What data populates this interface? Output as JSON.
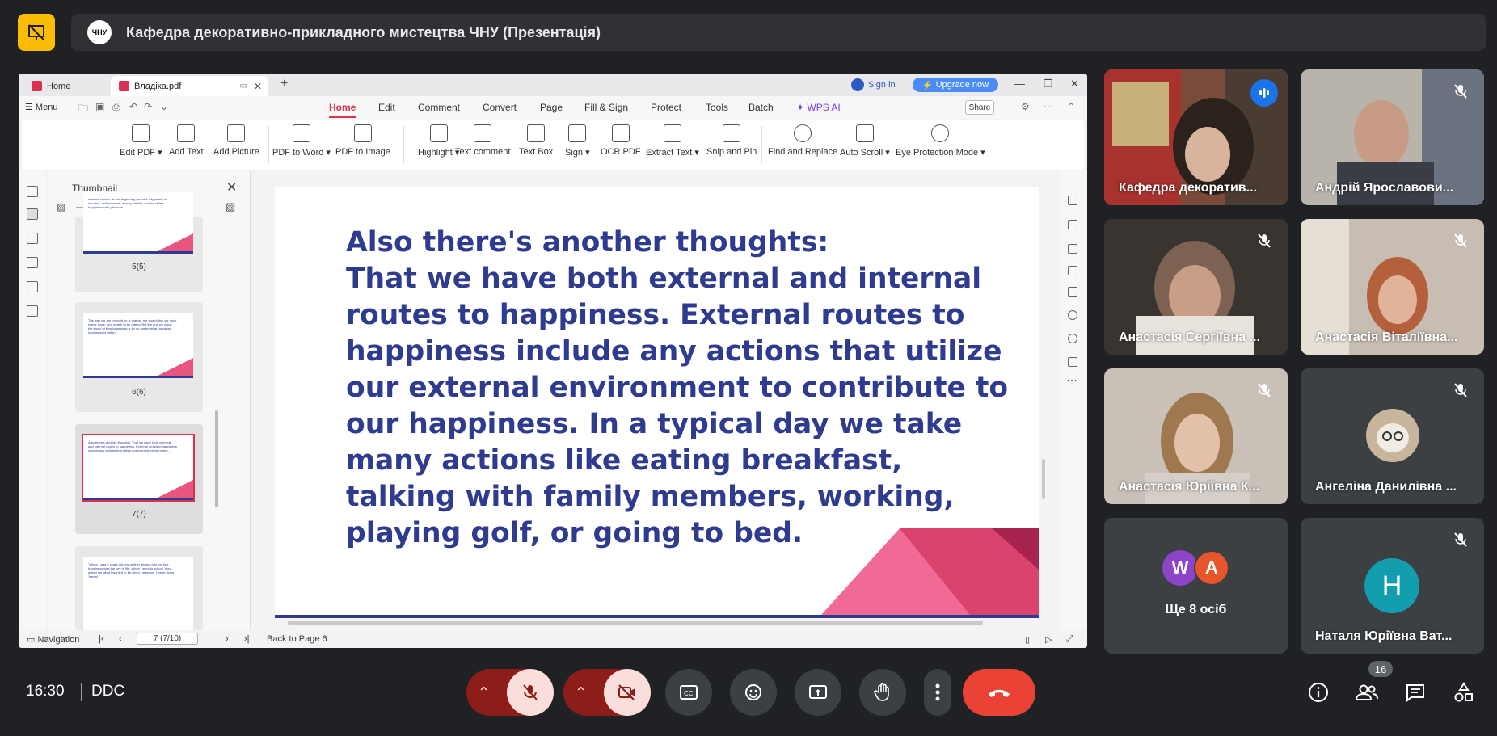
{
  "meeting": {
    "presentation_title": "Кафедра декоративно-прикладного мистецтва ЧНУ (Презентація)",
    "clock": "16:30",
    "meeting_code": "DDC",
    "participants_count": "16"
  },
  "browser": {
    "tabs": [
      {
        "label": "Home"
      },
      {
        "label": "Владіка.pdf"
      }
    ],
    "sign_in": "Sign in",
    "upgrade": "Upgrade now"
  },
  "pdf_app": {
    "menu_label": "Menu",
    "menu_tabs": [
      "Home",
      "Edit",
      "Comment",
      "Convert",
      "Page",
      "Fill & Sign",
      "Protect",
      "Tools",
      "Batch",
      "WPS AI"
    ],
    "share": "Share",
    "ribbon": [
      {
        "label": "Edit PDF ▾"
      },
      {
        "label": "Add Text"
      },
      {
        "label": "Add Picture"
      },
      {
        "label": "PDF to Word ▾"
      },
      {
        "label": "PDF to Image"
      },
      {
        "label": "Highlight ▾"
      },
      {
        "label": "Text comment"
      },
      {
        "label": "Text Box"
      },
      {
        "label": "Sign ▾"
      },
      {
        "label": "OCR PDF"
      },
      {
        "label": "Extract Text ▾"
      },
      {
        "label": "Snip and Pin"
      },
      {
        "label": "Find and Replace"
      },
      {
        "label": "Auto Scroll ▾"
      },
      {
        "label": "Eye Protection Mode ▾"
      }
    ],
    "thumbnail_title": "Thumbnail",
    "thumbnails": [
      {
        "label": "5(5)",
        "text": "external factors. In the beginning we think happiness is success, achievement, money, wealth, and we relate happiness with pleasure."
      },
      {
        "label": "6(6)",
        "text": "The way we are brought up is that we are taught that we must marry, have, and wealth to be happy. But the one we value the study of how happiness is by no matter what, because happiness is within."
      },
      {
        "label": "7(7)",
        "text": "Also there's another thoughts: That we have both external and internal routes to happiness. External routes to happiness include any actions that utilize our external environment..."
      },
      {
        "label": "",
        "text": "\"When I was 5 years old, my mother always told me that happiness was the key to life. When I went to school, they asked me what I wanted to be when I grew up. I wrote down 'happy'.\""
      }
    ],
    "slide_text": "Also there's another thoughts:\nThat we have both external and internal routes to happiness. External routes to happiness include any actions that utilize our external environment to contribute to our happiness. In a typical day we take many actions like eating breakfast, talking with family members, working, playing golf, or going to bed.",
    "status": {
      "navigation": "Navigation",
      "page_indicator": "7 (7/10)",
      "back": "Back to Page 6"
    }
  },
  "participants": [
    {
      "name": "Кафедра декоратив...",
      "speaking": true
    },
    {
      "name": "Андрій Ярославови...",
      "muted": true
    },
    {
      "name": "Анастасія Сергіївна ...",
      "muted": true
    },
    {
      "name": "Анастасія Віталіївна...",
      "muted": true
    },
    {
      "name": "Анастасія Юріївна К...",
      "muted": true
    },
    {
      "name": "Ангеліна Данилівна ...",
      "muted": true
    },
    {
      "name": "Ще 8 осіб",
      "avatars": [
        "W",
        "A"
      ]
    },
    {
      "name": "Наталя Юріївна Ват...",
      "muted": true,
      "avatar": "Н"
    }
  ],
  "colors": {
    "accent_red": "#ea4335",
    "present_yellow": "#fbbc04",
    "slide_text": "#2f3b8f",
    "slide_pink": "#e8557f",
    "wps_red": "#d9314f"
  }
}
